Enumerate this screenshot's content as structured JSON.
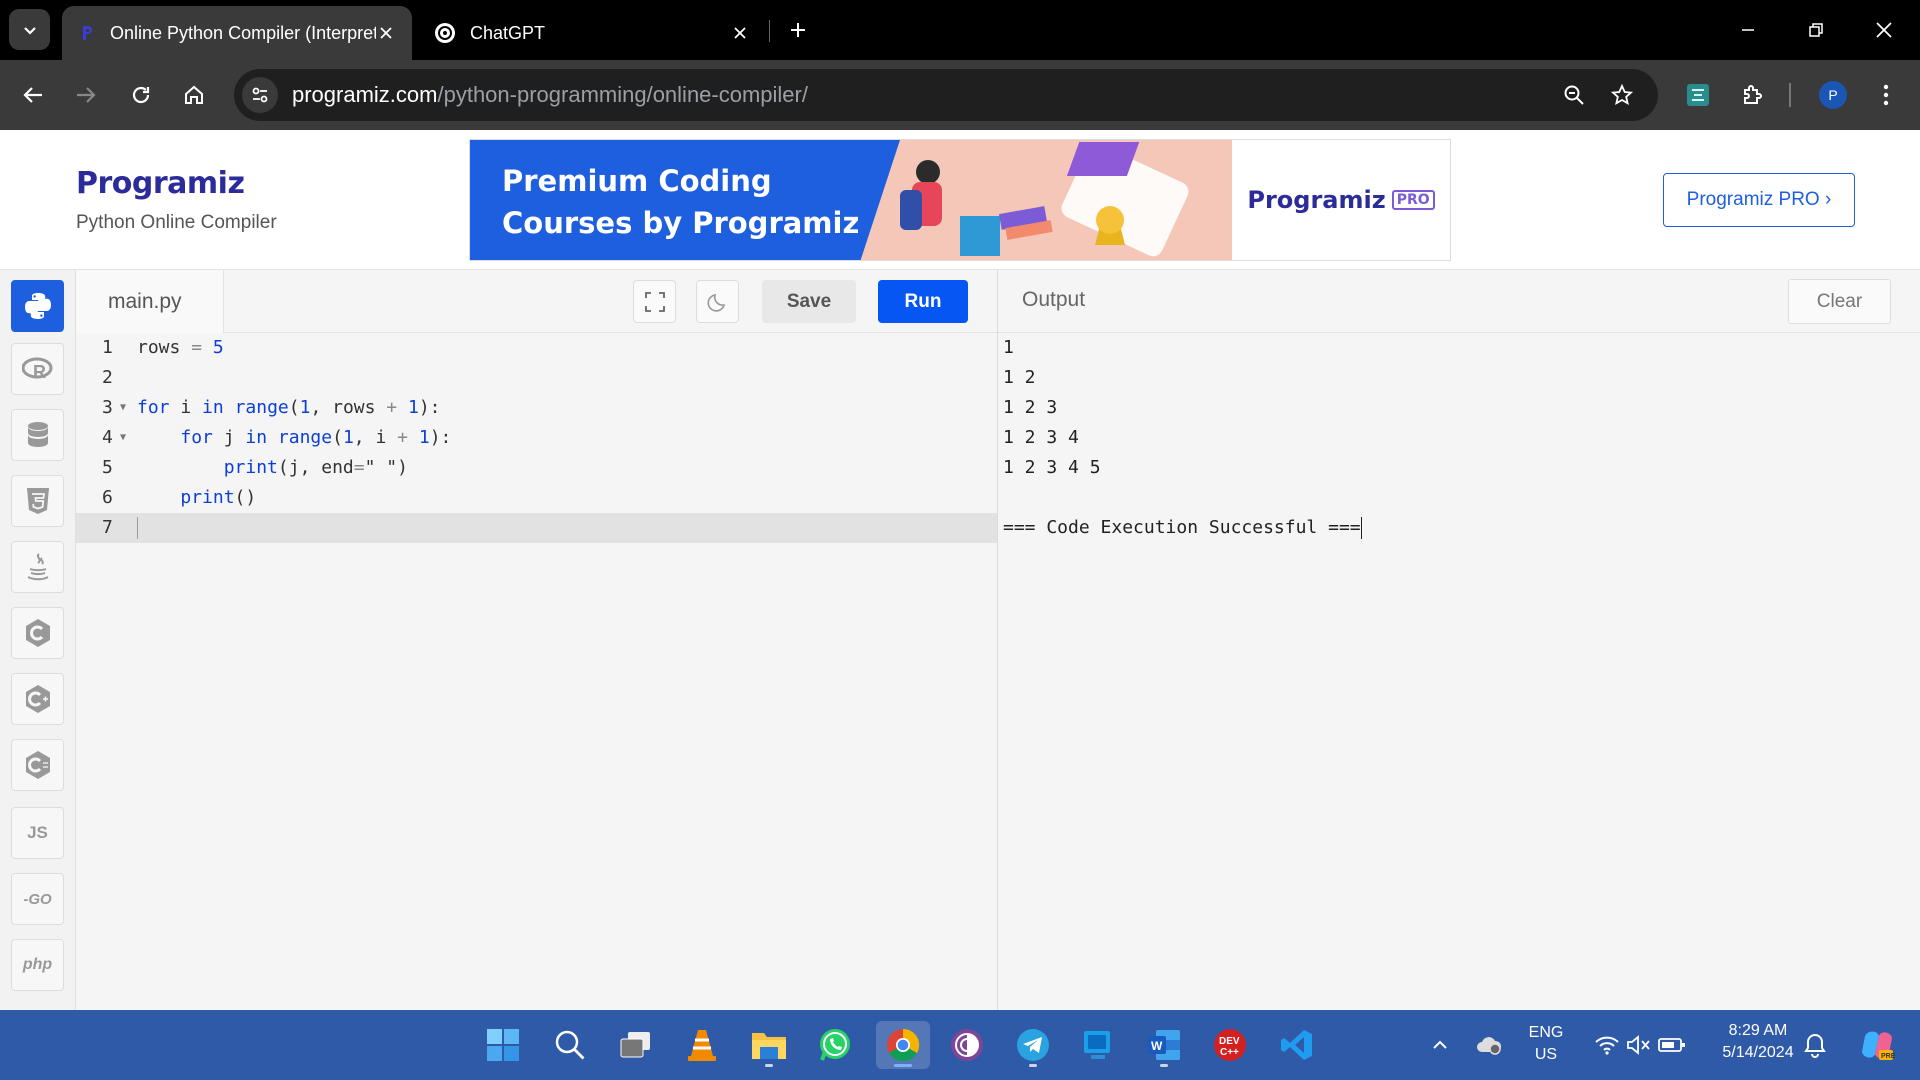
{
  "browser": {
    "tabs": [
      {
        "title": "Online Python Compiler (Interpreter)",
        "icon": "programiz-favicon",
        "active": true
      },
      {
        "title": "ChatGPT",
        "icon": "chatgpt-favicon",
        "active": false
      }
    ],
    "url": {
      "host": "programiz.com",
      "path": "/python-programming/online-compiler/"
    }
  },
  "site": {
    "logo_text": "Programiz",
    "subtitle": "Python Online Compiler",
    "banner": {
      "headline_line1": "Premium Coding",
      "headline_line2": "Courses by Programiz",
      "brand": "Programiz",
      "badge": "PRO"
    },
    "pro_button": "Programiz PRO ›"
  },
  "languages": [
    {
      "name": "python-icon"
    },
    {
      "name": "r-icon"
    },
    {
      "name": "sql-icon"
    },
    {
      "name": "html5-icon"
    },
    {
      "name": "java-icon"
    },
    {
      "name": "c-icon"
    },
    {
      "name": "cpp-icon"
    },
    {
      "name": "csharp-icon"
    },
    {
      "name": "js-icon",
      "label": "JS"
    },
    {
      "name": "go-icon",
      "label": "-GO"
    },
    {
      "name": "php-icon",
      "label": "php"
    }
  ],
  "editor": {
    "filename": "main.py",
    "save_label": "Save",
    "run_label": "Run",
    "line_numbers": [
      "1",
      "2",
      "3",
      "4",
      "5",
      "6",
      "7"
    ]
  },
  "output": {
    "label": "Output",
    "clear_label": "Clear",
    "lines": [
      "1",
      "1 2",
      "1 2 3",
      "1 2 3 4",
      "1 2 3 4 5",
      "",
      "=== Code Execution Successful ==="
    ]
  },
  "taskbar": {
    "lang_top": "ENG",
    "lang_bottom": "US",
    "time": "8:29 AM",
    "date": "5/14/2024"
  },
  "colors": {
    "accent": "#0556f3",
    "taskbar": "#2f5aa8"
  }
}
